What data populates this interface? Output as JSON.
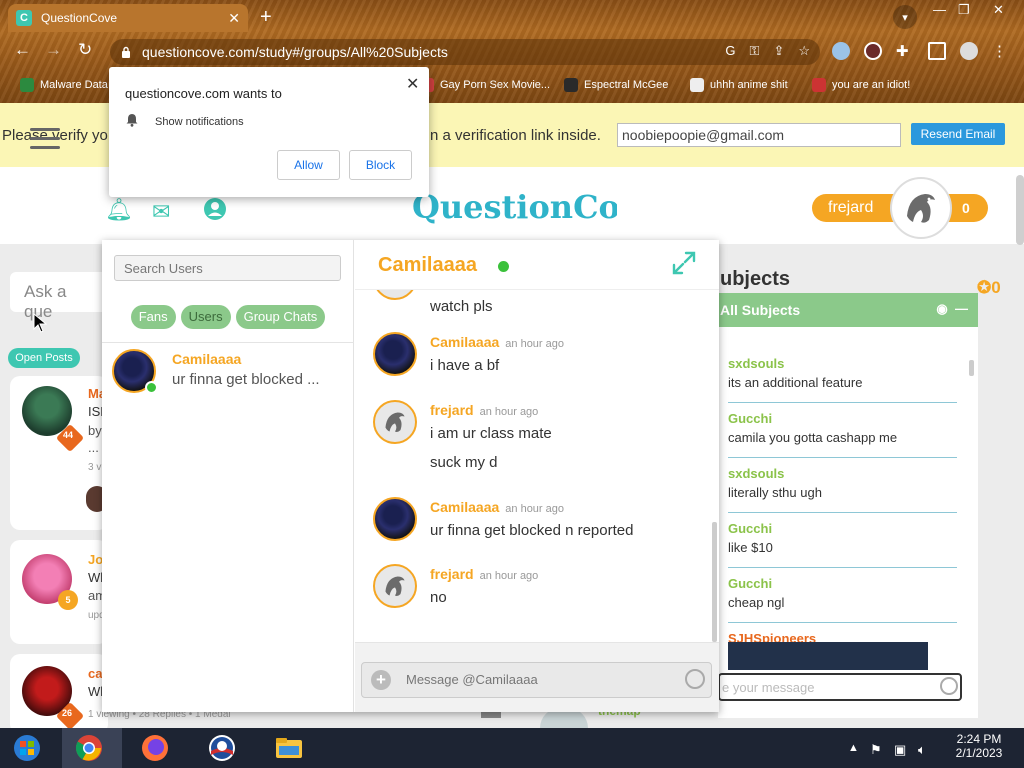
{
  "browser": {
    "tab_title": "QuestionCove",
    "tab_favicon": "C",
    "url": "questioncove.com/study#/groups/All%20Subjects",
    "new_tab_glyph": "+",
    "close_tab_glyph": "✕",
    "window_controls": {
      "minimize": "—",
      "restore": "❐",
      "close": "✕"
    },
    "bookmarks": [
      {
        "label": "Malware Data"
      },
      {
        "label": "Gay Porn Sex Movie..."
      },
      {
        "label": "Espectral McGee"
      },
      {
        "label": "uhhh anime shit"
      },
      {
        "label": "you are an idiot!"
      }
    ]
  },
  "notification_prompt": {
    "title": "questioncove.com wants to",
    "permission": "Show notifications",
    "allow_label": "Allow",
    "block_label": "Block"
  },
  "verify_bar": {
    "text_left": "Please verify yo",
    "text_right": "n a verification link inside.",
    "email_value": "noobiepoopie@gmail.com",
    "resend_label": "Resend Email"
  },
  "header": {
    "logo": "QuestionCove",
    "username": "frejard",
    "points": "0"
  },
  "background": {
    "ask_placeholder": "Ask a que",
    "open_posts": "Open Posts",
    "cards": [
      {
        "name": "Ma",
        "line1": "ISH",
        "line2": "by",
        "line3": "...",
        "meta": "3 vi",
        "badge": "44",
        "badge_color": "#e8681e"
      },
      {
        "name": "Jos",
        "line1": "Wh",
        "line2": "am",
        "line3": "",
        "meta": "upd",
        "badge": "5",
        "badge_color": "#f5a623"
      },
      {
        "name": "ca",
        "line1": "Wh",
        "line2": "",
        "line3": "",
        "meta": "",
        "badge": "26",
        "badge_color": "#e8681e"
      }
    ],
    "footer_meta": "1 viewing  •  28 Replies  •  1 Medal"
  },
  "subjects_panel": {
    "title_partial": "ubjects",
    "medal_count": "0",
    "group_name": "All Subjects",
    "messages": [
      {
        "user": "sxdsouls",
        "text": "its an additional feature"
      },
      {
        "user": "Gucchi",
        "text": "camila you gotta cashapp me"
      },
      {
        "user": "sxdsouls",
        "text": "literally sthu ugh"
      },
      {
        "user": "Gucchi",
        "text": "like $10"
      },
      {
        "user": "Gucchi",
        "text": "cheap ngl"
      },
      {
        "user": "SJHSpioneers",
        "text": ""
      }
    ],
    "input_placeholder": "e your message",
    "bottom_user": "themap"
  },
  "chat": {
    "search_placeholder": "Search Users",
    "tabs": [
      {
        "label": "Fans"
      },
      {
        "label": "Users"
      },
      {
        "label": "Group Chats"
      }
    ],
    "conversation": {
      "name": "Camilaaaa",
      "preview": "ur finna get blocked ..."
    },
    "active_contact": "Camilaaaa",
    "messages": [
      {
        "user": "",
        "time": "",
        "lines": [
          "watch pls"
        ],
        "avatar": "frejard"
      },
      {
        "user": "Camilaaaa",
        "time": "an hour ago",
        "lines": [
          "i have a bf"
        ],
        "avatar": "camila"
      },
      {
        "user": "frejard",
        "time": "an hour ago",
        "lines": [
          "i am ur class mate",
          "suck my d"
        ],
        "avatar": "frejard"
      },
      {
        "user": "Camilaaaa",
        "time": "an hour ago",
        "lines": [
          "ur finna get blocked n reported"
        ],
        "avatar": "camila"
      },
      {
        "user": "frejard",
        "time": "an hour ago",
        "lines": [
          "no"
        ],
        "avatar": "frejard"
      }
    ],
    "input_placeholder": "Message @Camilaaaa"
  },
  "taskbar": {
    "time": "2:24 PM",
    "date": "2/1/2023"
  },
  "colors": {
    "brand_teal": "#3ec7b1",
    "accent_orange": "#f5a623",
    "online_green": "#3bc13b",
    "chip_green": "#8bc98a",
    "verify_yellow": "#fbf6b5"
  }
}
